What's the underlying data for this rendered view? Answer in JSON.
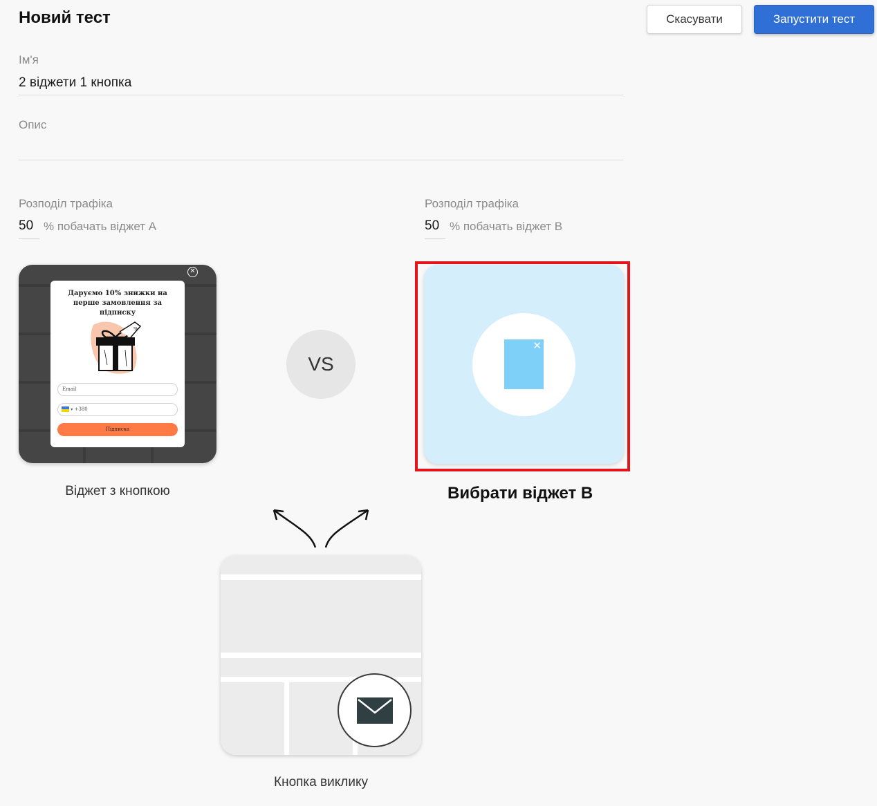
{
  "header": {
    "title": "Новий тест",
    "cancel_label": "Скасувати",
    "run_label": "Запустити тест"
  },
  "form": {
    "name_label": "Ім'я",
    "name_value": "2 віджети 1 кнопка",
    "description_label": "Опис",
    "description_value": ""
  },
  "traffic_a": {
    "label": "Розподіл трафіка",
    "value": "50",
    "suffix": "% побачать віджет A"
  },
  "traffic_b": {
    "label": "Розподіл трафіка",
    "value": "50",
    "suffix": "% побачать віджет B"
  },
  "widget_a": {
    "caption": "Віджет з кнопкою",
    "popup_title": "Даруємо 10% знижки на перше замовлення за підписку",
    "email_placeholder": "Email",
    "phone_prefix": "+380",
    "subscribe_label": "Підписка"
  },
  "vs_label": "VS",
  "widget_b": {
    "choose_label": "Вибрати віджет B"
  },
  "trigger": {
    "caption": "Кнопка виклику"
  },
  "colors": {
    "primary": "#2f6fd6",
    "selection": "#e3141b",
    "widget_b_bg": "#d4eefc",
    "popup_button": "#ff7a45"
  }
}
